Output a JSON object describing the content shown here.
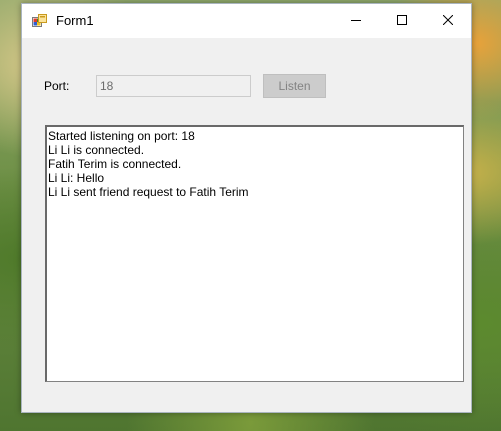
{
  "window": {
    "title": "Form1",
    "icon": "windows-forms-app-icon"
  },
  "title_controls": {
    "minimize_icon": "minimize-icon",
    "maximize_icon": "maximize-icon",
    "close_icon": "close-icon"
  },
  "port": {
    "label": "Port:",
    "value": "18",
    "enabled": false
  },
  "listen_button": {
    "label": "Listen",
    "enabled": false
  },
  "log": {
    "lines": [
      "Started listening on port: 18",
      "Li Li is connected.",
      "Fatih Terim is connected.",
      "Li Li: Hello",
      "Li Li sent friend request to Fatih Terim"
    ]
  },
  "colors": {
    "window_bg": "#f0f0f0",
    "titlebar_bg": "#ffffff",
    "disabled_button_bg": "#cccccc",
    "disabled_text": "#838383"
  }
}
